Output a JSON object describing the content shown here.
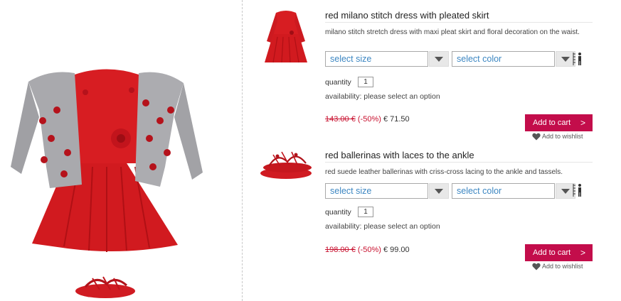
{
  "products": [
    {
      "title": "red milano stitch dress with pleated skirt",
      "description": "milano stitch stretch dress with maxi pleat skirt and floral decoration on the waist.",
      "size_select": "select size",
      "color_select": "select color",
      "fit_icon": "size-guide-icon",
      "quantity_label": "quantity",
      "quantity": "1",
      "availability": "availability: please select an option",
      "old_price": "143.00 €",
      "discount": "(-50%)",
      "new_price": "€ 71.50",
      "cart_label": "Add to cart",
      "cart_chevron": ">",
      "wishlist_label": "Add to wishlist"
    },
    {
      "title": "red ballerinas with laces to the ankle",
      "description": "red suede leather ballerinas with criss-cross lacing to the ankle and tassels.",
      "size_select": "select size",
      "color_select": "select color",
      "fit_icon": "size-guide-icon",
      "quantity_label": "quantity",
      "quantity": "1",
      "availability": "availability: please select an option",
      "old_price": "198.00 €",
      "discount": "(-50%)",
      "new_price": "€ 99.00",
      "cart_label": "Add to cart",
      "cart_chevron": ">",
      "wishlist_label": "Add to wishlist"
    }
  ],
  "colors": {
    "accent_red": "#c30d4b",
    "price_red": "#c8102e",
    "link_blue": "#3d87c2"
  }
}
